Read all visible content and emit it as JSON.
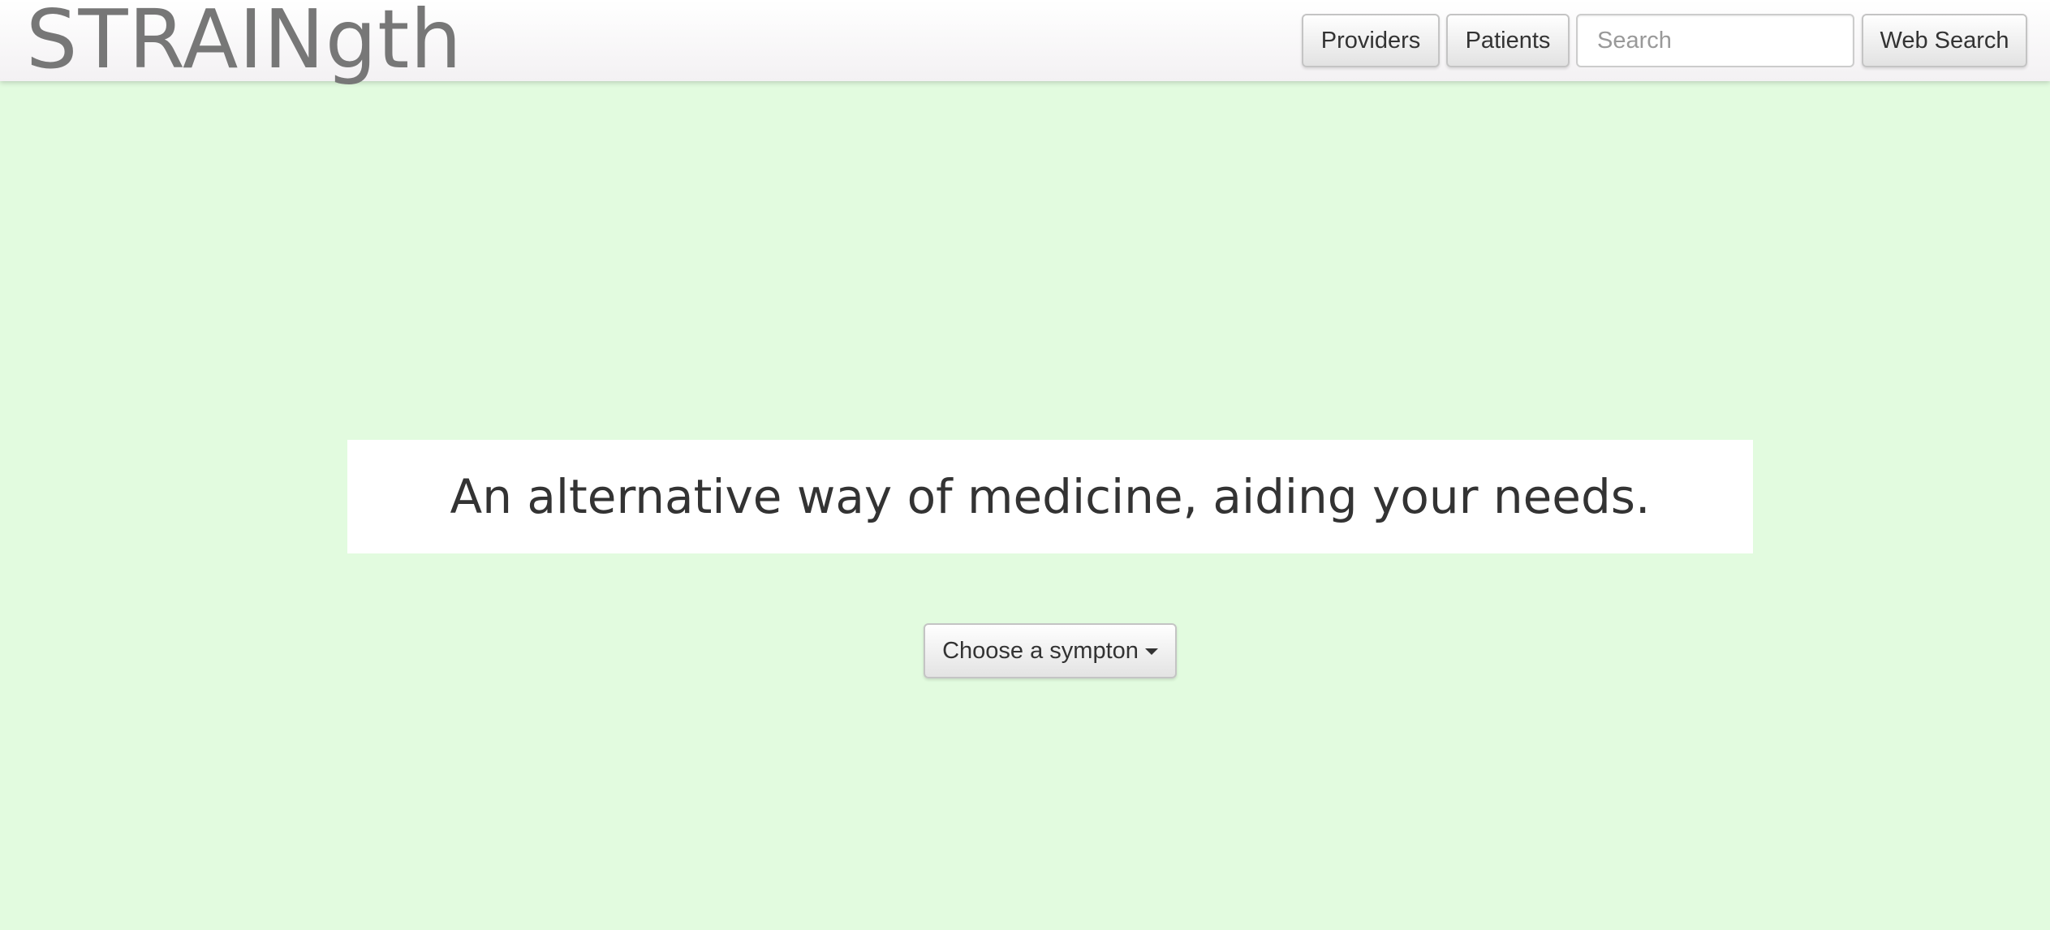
{
  "navbar": {
    "brand": "STRAINgth",
    "providers_label": "Providers",
    "patients_label": "Patients",
    "search_placeholder": "Search",
    "search_value": "",
    "web_search_label": "Web Search"
  },
  "main": {
    "tagline": "An alternative way of medicine, aiding your needs.",
    "symptom_dropdown_label": "Choose a sympton",
    "symptom_dropdown_icon": "caret-down-icon"
  },
  "colors": {
    "page_background": "#e2fbdf",
    "navbar_background": "#f8f7f8",
    "brand_text": "#777777",
    "tagline_background": "#ffffff",
    "tagline_text": "#333333"
  }
}
